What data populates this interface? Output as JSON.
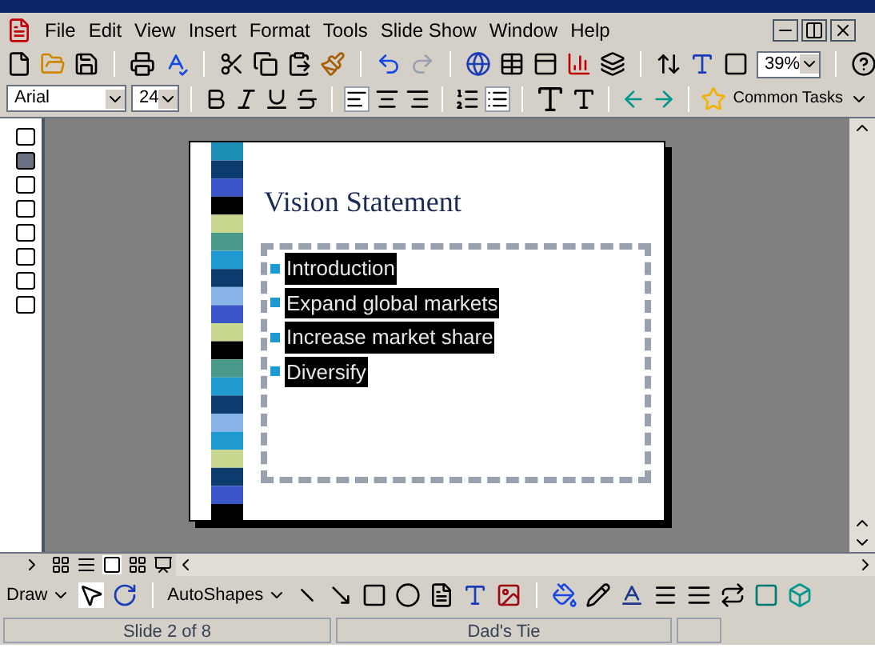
{
  "menu": [
    "File",
    "Edit",
    "View",
    "Insert",
    "Format",
    "Tools",
    "Slide Show",
    "Window",
    "Help"
  ],
  "zoom": {
    "value": "39%"
  },
  "font": {
    "name": "Arial",
    "size": "24"
  },
  "common_tasks": "Common Tasks",
  "outline": [
    {
      "selected": false
    },
    {
      "selected": true
    },
    {
      "selected": false
    },
    {
      "selected": false
    },
    {
      "selected": false
    },
    {
      "selected": false
    },
    {
      "selected": false
    },
    {
      "selected": false
    }
  ],
  "slide": {
    "title": "Vision Statement",
    "bullets": [
      "Introduction",
      "Expand global markets",
      "Increase market share",
      "Diversify"
    ]
  },
  "draw_toolbar": {
    "draw": "Draw",
    "autoshapes": "AutoShapes"
  },
  "status_bar": [
    "Slide 2 of 8",
    "Dad's Tie"
  ]
}
